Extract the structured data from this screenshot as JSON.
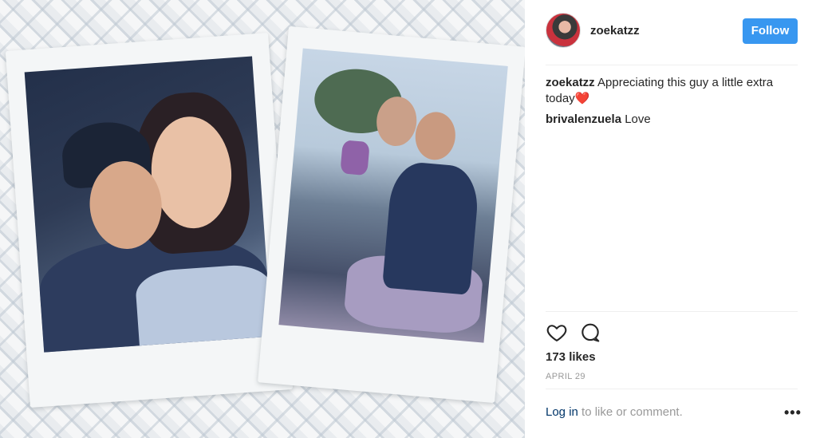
{
  "post": {
    "username": "zoekatzz",
    "follow_label": "Follow",
    "comments": [
      {
        "user": "zoekatzz",
        "text": "Appreciating this guy a little extra today",
        "emoji": "❤️"
      },
      {
        "user": "brivalenzuela",
        "text": "Love"
      }
    ],
    "likes": "173 likes",
    "date": "APRIL 29",
    "login_link": "Log in",
    "login_text": "to like or comment.",
    "more_label": "•••"
  },
  "colors": {
    "accent": "#3897f0",
    "link": "#003569",
    "muted": "#999999",
    "text": "#262626"
  },
  "icons": [
    "heart-icon",
    "comment-icon",
    "more-options-icon"
  ]
}
